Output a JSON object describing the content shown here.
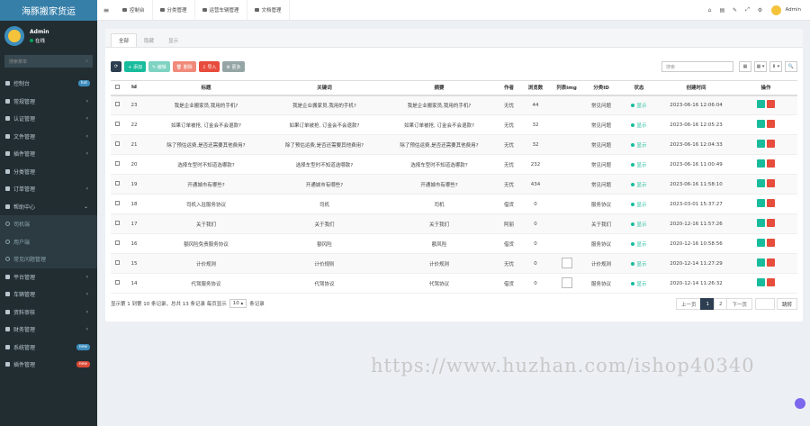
{
  "app": {
    "logo": "海豚搬家货运"
  },
  "user": {
    "name": "Admin",
    "status": "在线"
  },
  "search": {
    "placeholder": "搜索菜单"
  },
  "menu": [
    {
      "label": "控制台",
      "badge": "hot",
      "badge_color": "#3c8dbc",
      "type": "main"
    },
    {
      "label": "常规管理",
      "arrow": "‹",
      "type": "main"
    },
    {
      "label": "认证管理",
      "arrow": "‹",
      "type": "main"
    },
    {
      "label": "文件管理",
      "arrow": "‹",
      "type": "main"
    },
    {
      "label": "插件管理",
      "arrow": "‹",
      "type": "main"
    },
    {
      "label": "分类管理",
      "type": "main"
    },
    {
      "label": "订单管理",
      "arrow": "‹",
      "type": "main"
    },
    {
      "label": "帮助中心",
      "arrow": "⌄",
      "type": "main"
    },
    {
      "label": "司机端",
      "type": "sub"
    },
    {
      "label": "用户端",
      "type": "sub"
    },
    {
      "label": "常见问题管理",
      "type": "sub"
    },
    {
      "label": "平台管理",
      "arrow": "‹",
      "type": "main"
    },
    {
      "label": "车辆管理",
      "arrow": "‹",
      "type": "main"
    },
    {
      "label": "资料审核",
      "arrow": "‹",
      "type": "main"
    },
    {
      "label": "财务管理",
      "arrow": "‹",
      "type": "main"
    },
    {
      "label": "系统管理",
      "badge": "new",
      "badge_color": "#3c8dbc",
      "type": "main"
    },
    {
      "label": "插件管理",
      "badge": "new",
      "badge_color": "#dd4b39",
      "type": "main"
    }
  ],
  "topbar": {
    "tabs": [
      "控制台",
      "分类管理",
      "运营车辆管理",
      "文档管理"
    ],
    "icons": [
      "⌂",
      "▤",
      "✎",
      "⤢",
      "⚙"
    ],
    "admin": "Admin"
  },
  "panel": {
    "tabs": [
      "全部",
      "隐藏",
      "显示"
    ]
  },
  "toolbar": [
    {
      "label": "⟳",
      "color": "#2c3e50"
    },
    {
      "label": "+ 添加",
      "color": "#18bc9c"
    },
    {
      "label": "✎ 编辑",
      "color": "#7ed3c2"
    },
    {
      "label": "🗑 删除",
      "color": "#f08a7a"
    },
    {
      "label": "⇩ 导入",
      "color": "#e74c3c"
    },
    {
      "label": "⚙ 更多",
      "color": "#95a5a6"
    }
  ],
  "rtools": {
    "search_placeholder": "搜索",
    "buttons": [
      "▦",
      "▦ ▾",
      "⬇ ▾",
      "🔍"
    ]
  },
  "table": {
    "headers": [
      "",
      "Id",
      "标题",
      "关键词",
      "摘要",
      "作者",
      "浏览数",
      "列表img",
      "分类ID",
      "状态",
      "创建时间",
      "操作"
    ],
    "rows": [
      {
        "id": "23",
        "title": "我是企业搬家员,我用的手机?",
        "kw": "我是企业搬家员,我用的手机?",
        "summary": "我是企业搬家员,我用的手机?",
        "author": "无忧",
        "views": "44",
        "img": false,
        "cat": "常见问题",
        "status": "显示",
        "time": "2023-06-16 12:06:04"
      },
      {
        "id": "22",
        "title": "如果订单被抢, 订金会不会退款?",
        "kw": "如果订单被抢, 订金会不会退款?",
        "summary": "如果订单被抢, 订金会不会退款?",
        "author": "无忧",
        "views": "32",
        "img": false,
        "cat": "常见问题",
        "status": "显示",
        "time": "2023-06-16 12:05:23"
      },
      {
        "id": "21",
        "title": "除了预估运费,是否还需要其他费用?",
        "kw": "除了预估运费,是否还需要其他费用?",
        "summary": "除了预估运费,是否还需要其他费用?",
        "author": "无忧",
        "views": "32",
        "img": false,
        "cat": "常见问题",
        "status": "显示",
        "time": "2023-06-16 12:04:33"
      },
      {
        "id": "20",
        "title": "选择车型时不知道选哪款?",
        "kw": "选择车型时不知道选哪款?",
        "summary": "选择车型时不知道选哪款?",
        "author": "无忧",
        "views": "232",
        "img": false,
        "cat": "常见问题",
        "status": "显示",
        "time": "2023-06-16 11:00:49"
      },
      {
        "id": "19",
        "title": "开通城市有哪些?",
        "kw": "开通城市有哪些?",
        "summary": "开通城市有哪些?",
        "author": "无忧",
        "views": "434",
        "img": false,
        "cat": "常见问题",
        "status": "显示",
        "time": "2023-06-16 11:58:10"
      },
      {
        "id": "18",
        "title": "司机入驻服务协议",
        "kw": "司机",
        "summary": "司机",
        "author": "借货",
        "views": "0",
        "img": false,
        "cat": "服务协议",
        "status": "显示",
        "time": "2023-03-01 15:37:27"
      },
      {
        "id": "17",
        "title": "关于我们",
        "kw": "关于我们",
        "summary": "关于我们",
        "author": "阿丽",
        "views": "0",
        "img": false,
        "cat": "关于我们",
        "status": "显示",
        "time": "2020-12-16 11:57:26"
      },
      {
        "id": "16",
        "title": "额风险免责服务协议",
        "kw": "额风险",
        "summary": "额风险",
        "author": "借货",
        "views": "0",
        "img": false,
        "cat": "服务协议",
        "status": "显示",
        "time": "2020-12-16 10:58:56"
      },
      {
        "id": "15",
        "title": "计价规则",
        "kw": "计价规则",
        "summary": "计价规则",
        "author": "无忧",
        "views": "0",
        "img": true,
        "cat": "计价规则",
        "status": "显示",
        "time": "2020-12-14 11:27:29"
      },
      {
        "id": "14",
        "title": "代驾服务协议",
        "kw": "代驾协议",
        "summary": "代驾协议",
        "author": "借货",
        "views": "0",
        "img": true,
        "cat": "服务协议",
        "status": "显示",
        "time": "2020-12-14 11:26:32"
      }
    ]
  },
  "footer": {
    "text": "显示第 1 到第 10 条记录，总共 13 条记录 每页显示",
    "page_size": "10 ▴",
    "suffix": "条记录"
  },
  "pager": {
    "prev": "上一页",
    "pages": [
      "1",
      "2"
    ],
    "current": "1",
    "next": "下一页",
    "jump": "跳转"
  },
  "watermark": "https://www.huzhan.com/ishop40340"
}
